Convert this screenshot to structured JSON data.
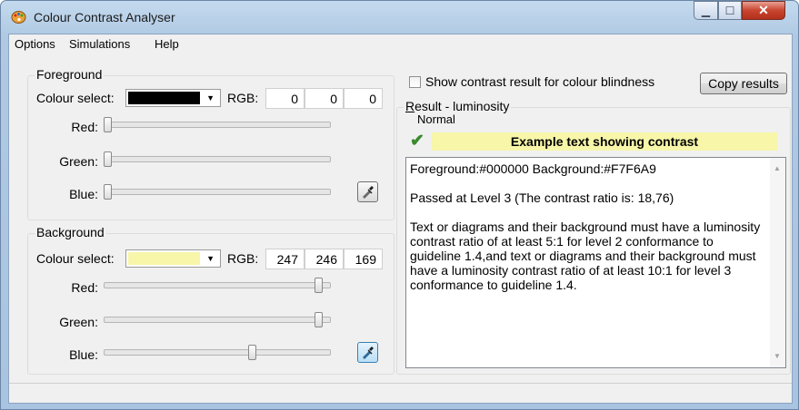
{
  "window": {
    "title": "Colour Contrast Analyser"
  },
  "menu": {
    "items": [
      "Options",
      "Simulations",
      "Help"
    ]
  },
  "foreground": {
    "legend": "Foreground",
    "colour_select_label": "Colour select:",
    "swatch_color": "#000000",
    "rgb_label": "RGB:",
    "r": "0",
    "g": "0",
    "b": "0",
    "red_label": "Red:",
    "green_label": "Green:",
    "blue_label": "Blue:",
    "red_level": 0,
    "green_level": 0,
    "blue_level": 0
  },
  "background": {
    "legend": "Background",
    "colour_select_label": "Colour select:",
    "swatch_color": "#F7F6A9",
    "rgb_label": "RGB:",
    "r": "247",
    "g": "246",
    "b": "169",
    "red_label": "Red:",
    "green_label": "Green:",
    "blue_label": "Blue:",
    "red_level": 247,
    "green_level": 246,
    "blue_level": 169
  },
  "options": {
    "colour_blindness_checkbox_label": "Show contrast result for colour blindness",
    "copy_results_label": "Copy results"
  },
  "result": {
    "legend_underlined": "R",
    "legend_rest": "esult - luminosity",
    "normal_label": "Normal",
    "example_text": "Example text showing contrast",
    "example_bg": "#F7F6A9",
    "pass_color": "#3c8a2e",
    "line1": "Foreground:#000000  Background:#F7F6A9",
    "line2": "Passed at Level 3 (The contrast ratio is: 18,76)",
    "line3": "Text or diagrams and their background must have a luminosity contrast ratio of at least 5:1 for level 2 conformance to guideline 1.4,and text or diagrams and their background must have a luminosity contrast ratio of at least 10:1 for level 3 conformance to guideline 1.4."
  }
}
